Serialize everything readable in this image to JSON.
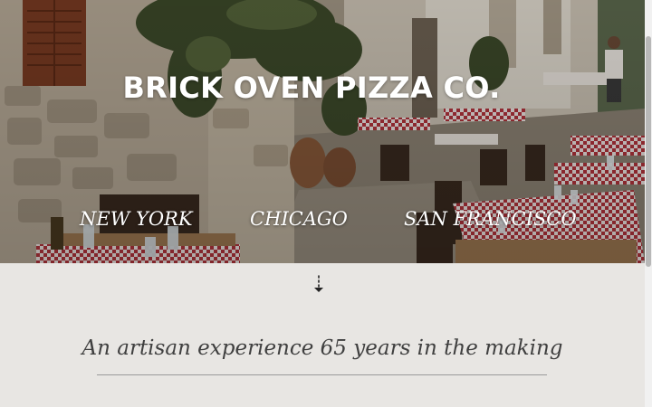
{
  "hero": {
    "title": "BRICK OVEN PIZZA CO.",
    "image_alt": "Outdoor restaurant terrace on a stone street with tables and red checkered tablecloths"
  },
  "nav": {
    "cities": [
      {
        "label": "NEW YORK"
      },
      {
        "label": "CHICAGO"
      },
      {
        "label": "SAN FRANCISCO"
      }
    ]
  },
  "tagline": {
    "text": "An artisan experience 65 years in the making"
  },
  "icons": {
    "scroll_down": "arrow-down-dashed-icon"
  },
  "colors": {
    "page_background": "#e8e6e3",
    "hero_text": "#ffffff",
    "tagline_text": "#3f3f3f",
    "tablecloth_red": "#b5343c",
    "stone_wall": "#b8ab98"
  }
}
